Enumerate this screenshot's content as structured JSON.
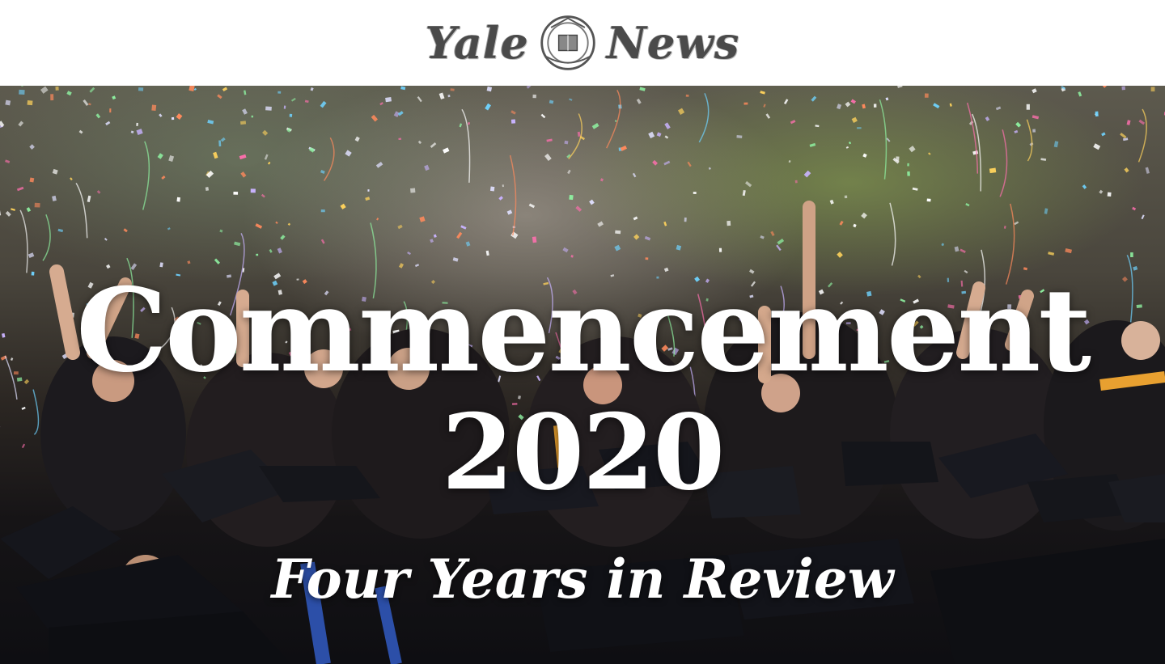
{
  "masthead": {
    "logo_left_word": "Yale",
    "logo_right_word": "News"
  },
  "hero": {
    "title_line_1": "Commencement",
    "title_line_2": "2020",
    "subtitle": "Four Years in Review",
    "text_color": "#ffffff"
  }
}
